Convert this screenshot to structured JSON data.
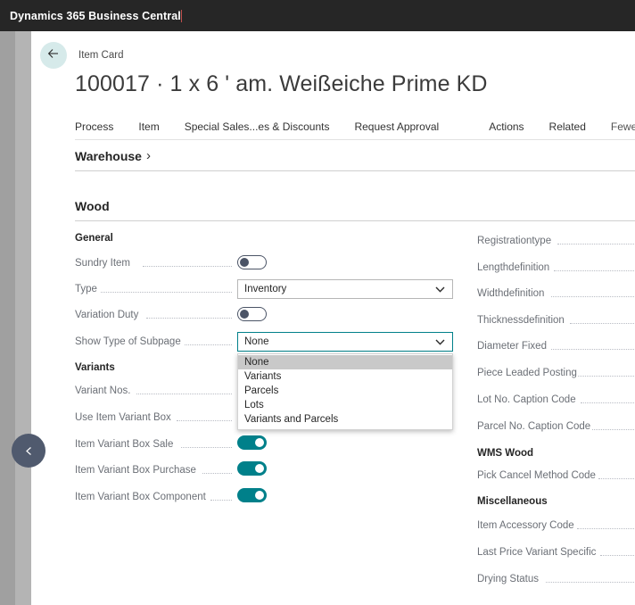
{
  "titlebar": {
    "app_title": "Dynamics 365 Business Central"
  },
  "nav": {
    "back_icon": "arrow-left-icon",
    "collapse_icon": "chevron-left-icon",
    "breadcrumb": "Item Card"
  },
  "page": {
    "title": "100017 · 1 x 6 ' am. Weißeiche Prime KD"
  },
  "action_menu": {
    "items": [
      {
        "label": "Process"
      },
      {
        "label": "Item"
      },
      {
        "label": "Special Sales...es & Discounts"
      },
      {
        "label": "Request Approval"
      },
      {
        "label": "Actions"
      },
      {
        "label": "Related"
      },
      {
        "label": "Fewer options"
      }
    ]
  },
  "sections": {
    "warehouse": {
      "title": "Warehouse",
      "chevron": "›"
    },
    "wood": {
      "title": "Wood"
    }
  },
  "left_column": {
    "group_general": "General",
    "group_variants": "Variants",
    "fields": [
      {
        "label": "Sundry Item",
        "control": "toggle",
        "value": "off"
      },
      {
        "label": "Type",
        "control": "select",
        "value": "Inventory"
      },
      {
        "label": "Variation Duty",
        "control": "toggle",
        "value": "off"
      },
      {
        "label": "Show Type of Subpage",
        "control": "select",
        "value": "None"
      },
      {
        "label": "Variant Nos.",
        "control": "input",
        "value": ""
      },
      {
        "label": "Use Item Variant Box",
        "control": "input",
        "value": ""
      },
      {
        "label": "Item Variant Box Sale",
        "control": "toggle",
        "value": "on"
      },
      {
        "label": "Item Variant Box Purchase",
        "control": "toggle",
        "value": "on"
      },
      {
        "label": "Item Variant Box Component",
        "control": "toggle",
        "value": "on"
      }
    ]
  },
  "dropdown": {
    "open": true,
    "selected": "None",
    "options": [
      "None",
      "Variants",
      "Parcels",
      "Lots",
      "Variants and Parcels"
    ]
  },
  "right_column": {
    "fields": [
      {
        "label": "Registrationtype",
        "type": "field"
      },
      {
        "label": "Lengthdefinition",
        "type": "field"
      },
      {
        "label": "Widthdefinition",
        "type": "field"
      },
      {
        "label": "Thicknessdefinition",
        "type": "field"
      },
      {
        "label": "Diameter Fixed",
        "type": "field"
      },
      {
        "label": "Piece Leaded Posting",
        "type": "field"
      },
      {
        "label": "Lot No. Caption Code",
        "type": "field"
      },
      {
        "label": "Parcel No. Caption Code",
        "type": "field"
      },
      {
        "label": "WMS Wood",
        "type": "group"
      },
      {
        "label": "Pick Cancel Method Code",
        "type": "field"
      },
      {
        "label": "Miscellaneous",
        "type": "group"
      },
      {
        "label": "Item Accessory Code",
        "type": "field"
      },
      {
        "label": "Last Price Variant Specific",
        "type": "field"
      },
      {
        "label": "Drying Status",
        "type": "field"
      }
    ]
  },
  "colors": {
    "titlebar_bg": "#262626",
    "accent_teal": "#00808a",
    "back_button_bg": "#d6eaea",
    "collapse_button_bg": "#505a6e",
    "label_gray": "#6b6f76"
  }
}
